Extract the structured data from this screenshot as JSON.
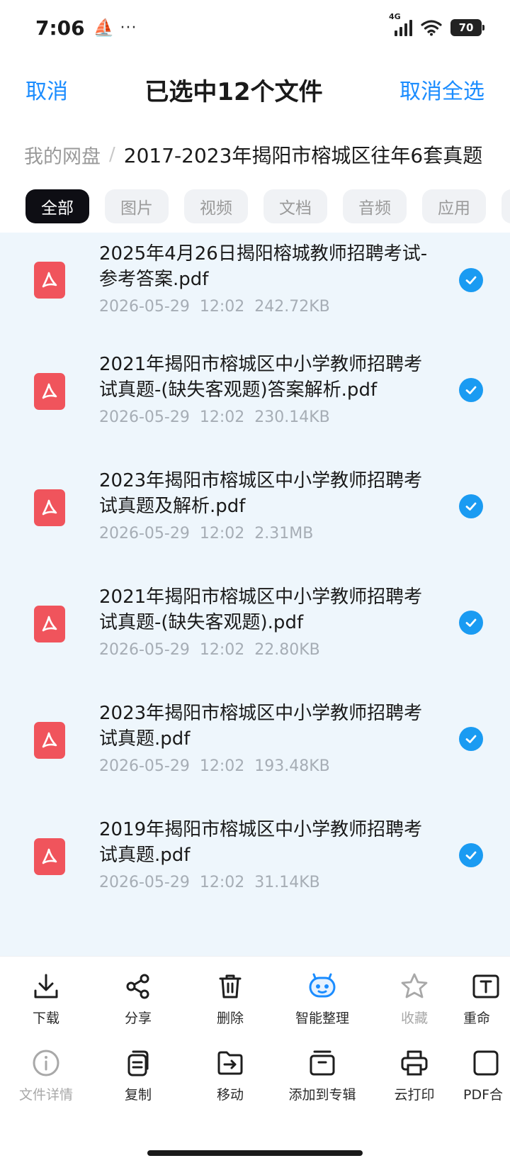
{
  "status": {
    "time": "7:06",
    "network": "4G",
    "battery": "70"
  },
  "header": {
    "cancel": "取消",
    "title": "已选中12个文件",
    "deselect_all": "取消全选"
  },
  "breadcrumb": {
    "root": "我的网盘",
    "current": "2017-2023年揭阳市榕城区往年6套真题"
  },
  "filters": [
    "全部",
    "图片",
    "视频",
    "文档",
    "音频",
    "应用"
  ],
  "files": [
    {
      "name": "2025年4月26日揭阳榕城教师招聘考试-参考答案.pdf",
      "date": "2026-05-29",
      "time": "12:02",
      "size": "242.72KB"
    },
    {
      "name": "2021年揭阳市榕城区中小学教师招聘考试真题-(缺失客观题)答案解析.pdf",
      "date": "2026-05-29",
      "time": "12:02",
      "size": "230.14KB"
    },
    {
      "name": "2023年揭阳市榕城区中小学教师招聘考试真题及解析.pdf",
      "date": "2026-05-29",
      "time": "12:02",
      "size": "2.31MB"
    },
    {
      "name": "2021年揭阳市榕城区中小学教师招聘考试真题-(缺失客观题).pdf",
      "date": "2026-05-29",
      "time": "12:02",
      "size": "22.80KB"
    },
    {
      "name": "2023年揭阳市榕城区中小学教师招聘考试真题.pdf",
      "date": "2026-05-29",
      "time": "12:02",
      "size": "193.48KB"
    },
    {
      "name": "2019年揭阳市榕城区中小学教师招聘考试真题.pdf",
      "date": "2026-05-29",
      "time": "12:02",
      "size": "31.14KB"
    }
  ],
  "actions_row1": [
    {
      "label": "下载",
      "icon": "download-icon"
    },
    {
      "label": "分享",
      "icon": "share-icon"
    },
    {
      "label": "删除",
      "icon": "trash-icon"
    },
    {
      "label": "智能整理",
      "icon": "smart-organize-icon"
    },
    {
      "label": "收藏",
      "icon": "star-icon"
    },
    {
      "label": "重命",
      "icon": "rename-icon"
    }
  ],
  "actions_row2": [
    {
      "label": "文件详情",
      "icon": "info-icon"
    },
    {
      "label": "复制",
      "icon": "copy-icon"
    },
    {
      "label": "移动",
      "icon": "move-icon"
    },
    {
      "label": "添加到专辑",
      "icon": "album-icon"
    },
    {
      "label": "云打印",
      "icon": "print-icon"
    },
    {
      "label": "PDF合",
      "icon": "pdf-merge-icon"
    }
  ],
  "colors": {
    "accent": "#1a8cff",
    "check": "#1a9bf2",
    "pdf": "#f0545c",
    "list_bg": "#eef6fc"
  }
}
